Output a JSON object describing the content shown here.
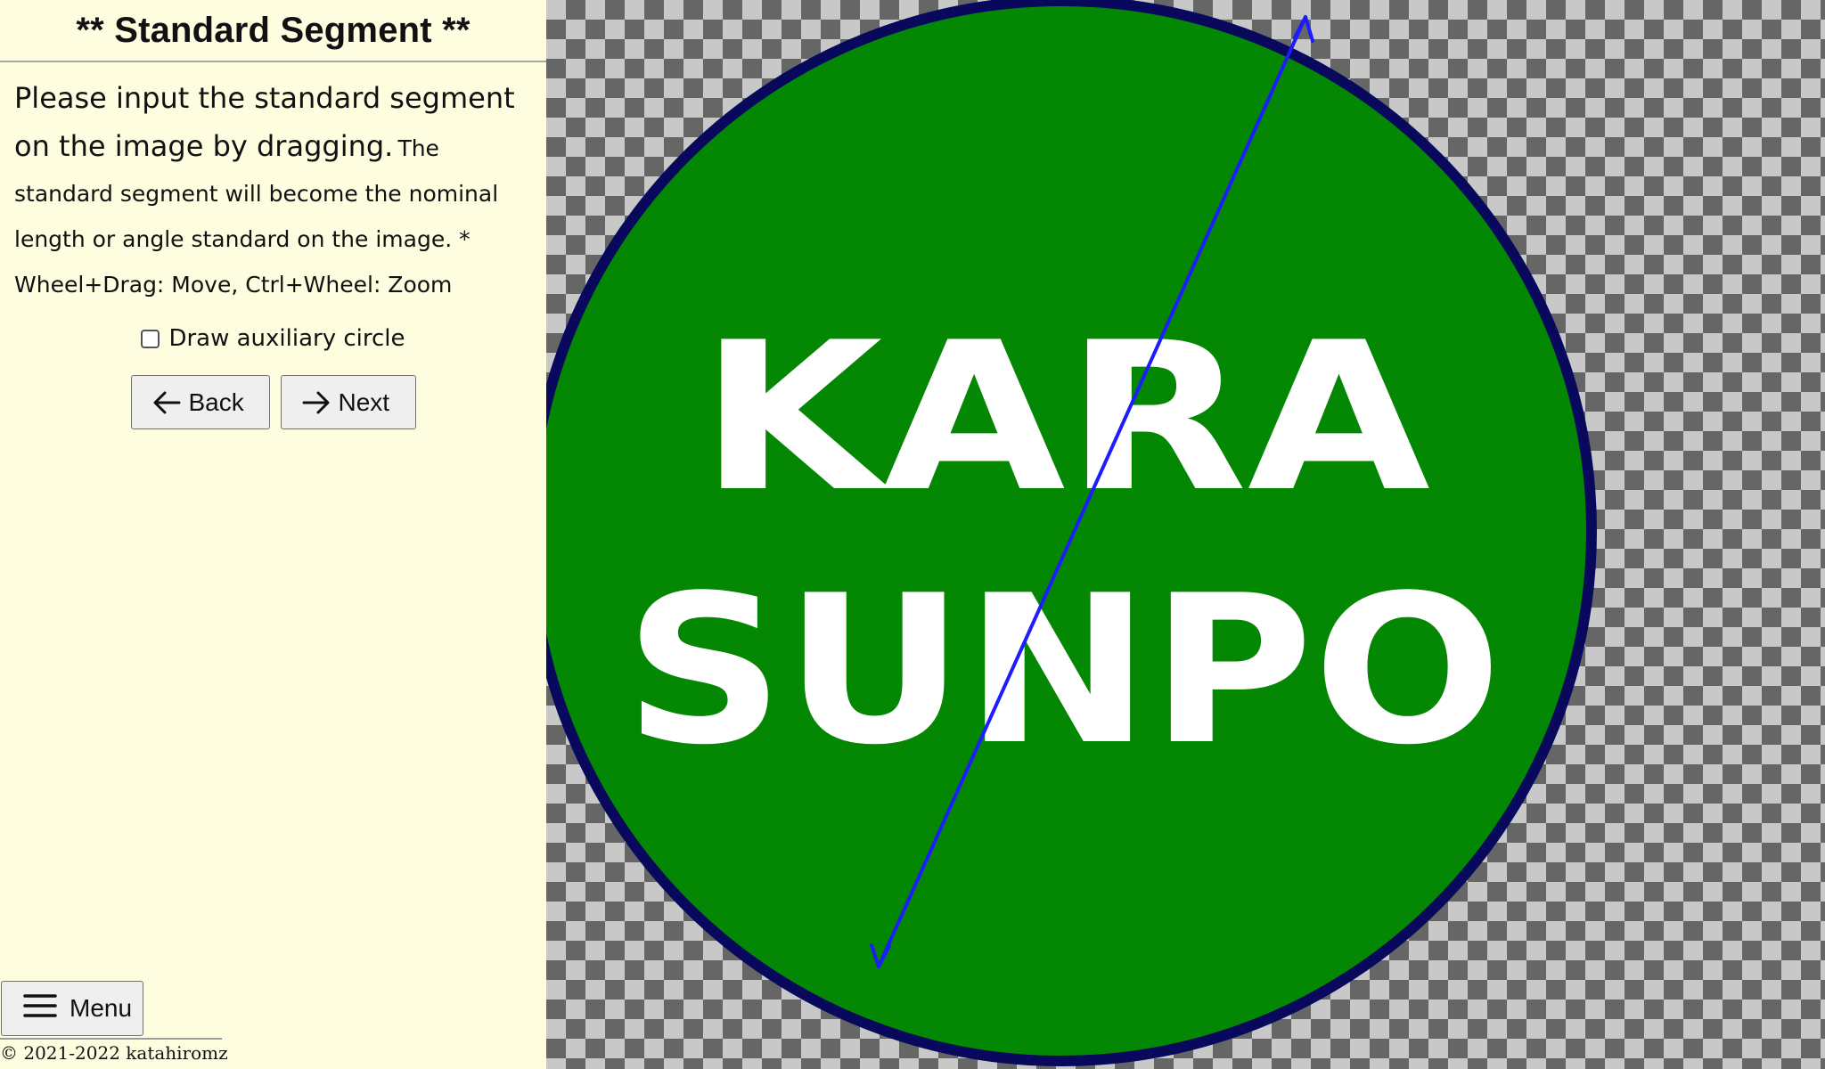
{
  "panel": {
    "title": "** Standard Segment **",
    "instruction_main": "Please input the standard segment on the image by dragging.",
    "instruction_sub": "The standard segment will become the nominal length or angle standard on the image. * Wheel+Drag: Move, Ctrl+Wheel: Zoom",
    "aux_circle_label": "Draw auxiliary circle",
    "aux_circle_checked": false,
    "back_label": "Back",
    "next_label": "Next",
    "menu_label": "Menu",
    "copyright": "© 2021-2022 katahiromz"
  },
  "canvas": {
    "image_text": {
      "line1": "KARA",
      "line2": "SUNPO"
    },
    "colors": {
      "circle_fill": "#048804",
      "circle_border": "#08085c",
      "logo_text": "#ffffff",
      "segment": "#1c1cff"
    }
  },
  "icons": {
    "back": "arrow-left-icon",
    "next": "arrow-right-icon",
    "menu": "hamburger-icon"
  }
}
